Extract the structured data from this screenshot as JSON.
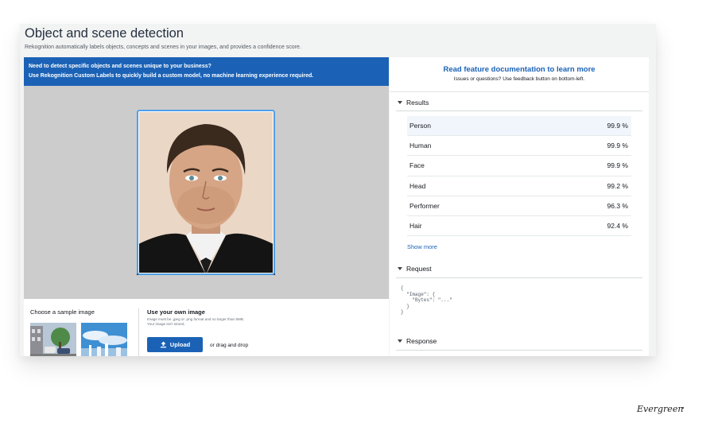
{
  "page": {
    "title": "Object and scene detection",
    "subtitle": "Rekognition automatically labels objects, concepts and scenes in your images, and provides a confidence score."
  },
  "promo": {
    "line1": "Need to detect specific objects and scenes unique to your business?",
    "line2": "Use Rekognition Custom Labels to quickly build a custom model, no machine learning experience required."
  },
  "samples": {
    "title": "Choose a sample image"
  },
  "own_image": {
    "title": "Use your own image",
    "hint": "Image must be .jpeg or .png format and no larger than 5MB. Your image isn't stored.",
    "upload_label": "Upload",
    "drag_label": "or drag and drop"
  },
  "docs": {
    "link": "Read feature documentation to learn more",
    "note": "Issues or questions? Use feedback button on bottom-left."
  },
  "sections": {
    "results": "Results",
    "request": "Request",
    "response": "Response"
  },
  "results": [
    {
      "label": "Person",
      "confidence": "99.9 %"
    },
    {
      "label": "Human",
      "confidence": "99.9 %"
    },
    {
      "label": "Face",
      "confidence": "99.9 %"
    },
    {
      "label": "Head",
      "confidence": "99.2 %"
    },
    {
      "label": "Performer",
      "confidence": "96.3 %"
    },
    {
      "label": "Hair",
      "confidence": "92.4 %"
    }
  ],
  "show_more": "Show more",
  "request_code": "{\n  \"Image\": {\n    \"Bytes\": \"...\"\n  }\n}",
  "watermark": "Evergreen",
  "colors": {
    "accent": "#1b62b6",
    "bbox": "#4f9fe6",
    "preview_bg": "#cccccc"
  },
  "icons": {
    "upload": "upload-icon",
    "section_toggle": "caret-down-icon"
  }
}
